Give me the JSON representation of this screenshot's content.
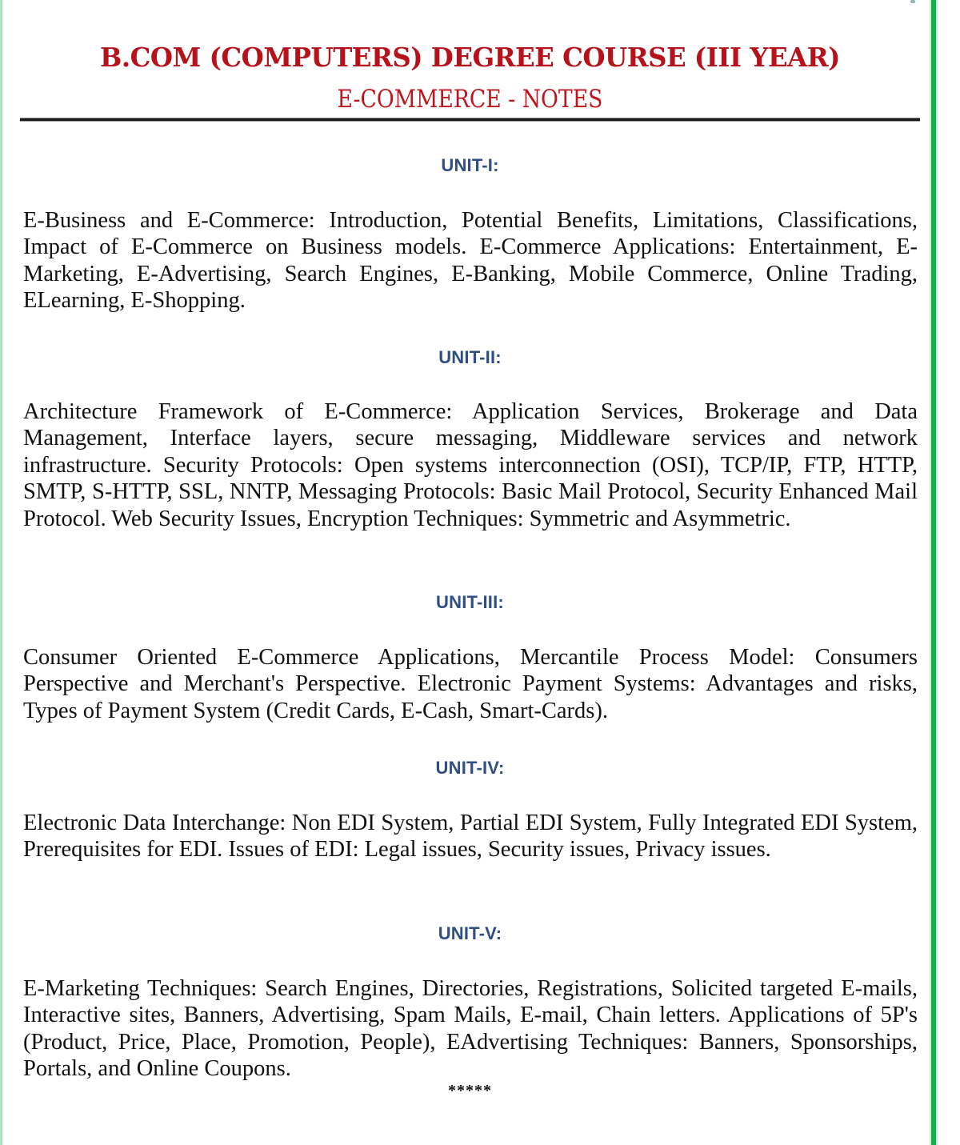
{
  "header": {
    "title": "B.COM (COMPUTERS) DEGREE COURSE (III YEAR)",
    "subtitle": "E-COMMERCE - NOTES"
  },
  "colors": {
    "title": "#b5121b",
    "unit_heading": "#2f4f82",
    "body_text": "#111111",
    "border_green": "#18b04f"
  },
  "units": [
    {
      "heading": "UNIT-I:",
      "body": "E-Business and E-Commerce: Introduction, Potential Benefits, Limitations, Classifications, Impact of E-Commerce on Business models. E-Commerce Applications: Entertainment, E-Marketing, E-Advertising, Search Engines, E-Banking, Mobile Commerce, Online Trading, ELearning, E-Shopping."
    },
    {
      "heading": "UNIT-II:",
      "body": "Architecture Framework of E-Commerce: Application Services, Brokerage and Data Management, Interface layers, secure messaging, Middleware services and network infrastructure. Security Protocols: Open systems interconnection (OSI), TCP/IP, FTP, HTTP, SMTP, S-HTTP, SSL, NNTP, Messaging Protocols: Basic Mail Protocol, Security Enhanced Mail Protocol. Web Security Issues, Encryption Techniques: Symmetric and Asymmetric."
    },
    {
      "heading": "UNIT-III:",
      "body": "Consumer Oriented E-Commerce Applications, Mercantile Process Model: Consumers Perspective and Merchant's Perspective. Electronic Payment Systems: Advantages and risks, Types of Payment System (Credit Cards, E-Cash, Smart-Cards)."
    },
    {
      "heading": "UNIT-IV:",
      "body": "Electronic Data Interchange: Non EDI System, Partial EDI System, Fully Integrated EDI System, Prerequisites for EDI. Issues of EDI: Legal issues, Security issues, Privacy issues."
    },
    {
      "heading": "UNIT-V:",
      "body": "E-Marketing Techniques:  Search Engines, Directories, Registrations, Solicited targeted E-mails, Interactive sites, Banners, Advertising, Spam Mails, E-mail, Chain letters. Applications of 5P's (Product, Price, Place, Promotion, People), EAdvertising Techniques: Banners, Sponsorships, Portals, and Online Coupons."
    }
  ],
  "end_mark": "*****"
}
